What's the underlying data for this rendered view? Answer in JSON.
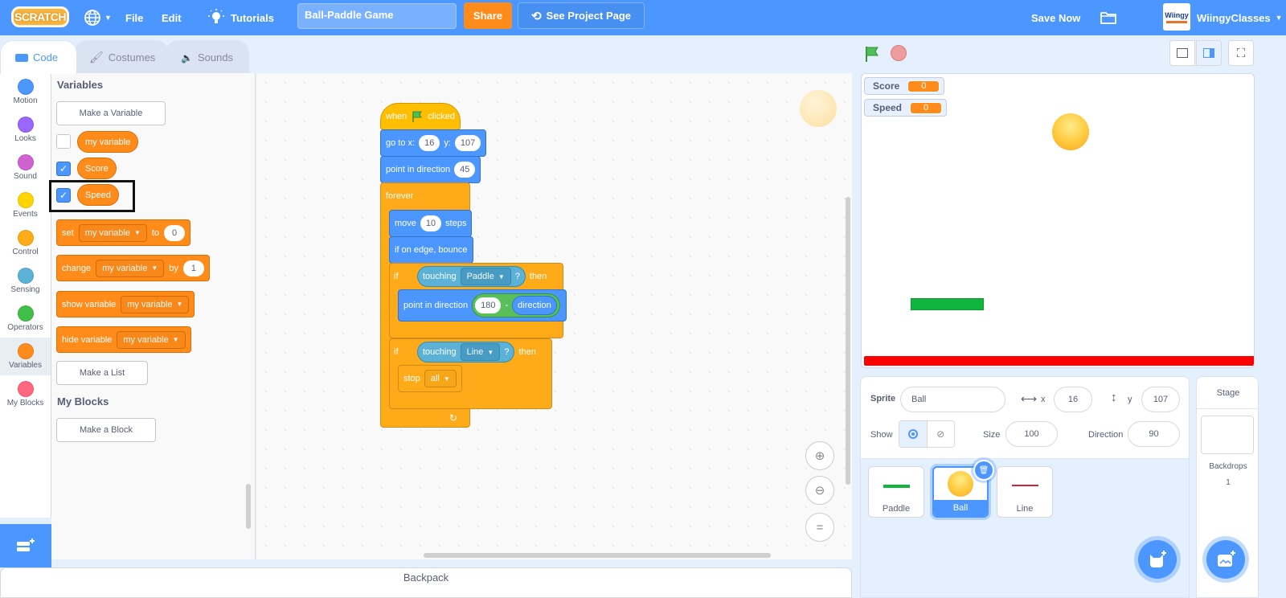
{
  "menubar": {
    "logo_text": "SCRATCH",
    "language_icon": "globe-icon",
    "file": "File",
    "edit": "Edit",
    "tutorials": "Tutorials",
    "project_title": "Ball-Paddle Game",
    "share": "Share",
    "see_project_page": "See Project Page",
    "save_now": "Save Now",
    "username": "WiingyClasses",
    "avatar_text": "Wiingy"
  },
  "tabs": [
    {
      "label": "Code",
      "active": true
    },
    {
      "label": "Costumes",
      "active": false
    },
    {
      "label": "Sounds",
      "active": false
    }
  ],
  "categories": [
    {
      "label": "Motion",
      "color": "#4c97ff"
    },
    {
      "label": "Looks",
      "color": "#9966ff"
    },
    {
      "label": "Sound",
      "color": "#cf63cf"
    },
    {
      "label": "Events",
      "color": "#ffd500"
    },
    {
      "label": "Control",
      "color": "#ffab19"
    },
    {
      "label": "Sensing",
      "color": "#5cb1d6"
    },
    {
      "label": "Operators",
      "color": "#40bf4a"
    },
    {
      "label": "Variables",
      "color": "#ff8c1a"
    },
    {
      "label": "My Blocks",
      "color": "#ff6680"
    }
  ],
  "palette": {
    "variables_heading": "Variables",
    "make_variable": "Make a Variable",
    "variables": [
      {
        "name": "my variable",
        "checked": false
      },
      {
        "name": "Score",
        "checked": true
      },
      {
        "name": "Speed",
        "checked": true
      }
    ],
    "set_block": {
      "label": "set",
      "var": "my variable",
      "to": "to",
      "value": "0"
    },
    "change_block": {
      "label": "change",
      "var": "my variable",
      "by": "by",
      "value": "1"
    },
    "show_block": {
      "label": "show variable",
      "var": "my variable"
    },
    "hide_block": {
      "label": "hide variable",
      "var": "my variable"
    },
    "make_list": "Make a List",
    "myblocks_heading": "My Blocks",
    "make_block": "Make a Block"
  },
  "script": {
    "when_flag": {
      "when": "when",
      "clicked": "clicked"
    },
    "goto": {
      "label": "go to x:",
      "x": "16",
      "y_label": "y:",
      "y": "107"
    },
    "point_dir": {
      "label": "point in direction",
      "value": "45"
    },
    "forever": "forever",
    "move": {
      "label": "move",
      "value": "10",
      "steps": "steps"
    },
    "bounce": "if on edge, bounce",
    "if1": {
      "if": "if",
      "touching": "touching",
      "target": "Paddle",
      "q": "?",
      "then": "then"
    },
    "point_dir2": {
      "label": "point in direction",
      "a": "180",
      "op": "-",
      "b": "direction"
    },
    "if2": {
      "if": "if",
      "touching": "touching",
      "target": "Line",
      "q": "?",
      "then": "then"
    },
    "stop": {
      "label": "stop",
      "option": "all"
    }
  },
  "backpack": "Backpack",
  "stage": {
    "monitors": [
      {
        "label": "Score",
        "value": "0"
      },
      {
        "label": "Speed",
        "value": "0"
      }
    ]
  },
  "sprite_info": {
    "sprite_label": "Sprite",
    "sprite_name": "Ball",
    "x_label": "x",
    "x": "16",
    "y_label": "y",
    "y": "107",
    "show_label": "Show",
    "size_label": "Size",
    "size": "100",
    "direction_label": "Direction",
    "direction": "90"
  },
  "sprites": [
    {
      "name": "Paddle",
      "selected": false
    },
    {
      "name": "Ball",
      "selected": true
    },
    {
      "name": "Line",
      "selected": false
    }
  ],
  "stage_panel": {
    "title": "Stage",
    "backdrops_label": "Backdrops",
    "backdrops_count": "1"
  }
}
